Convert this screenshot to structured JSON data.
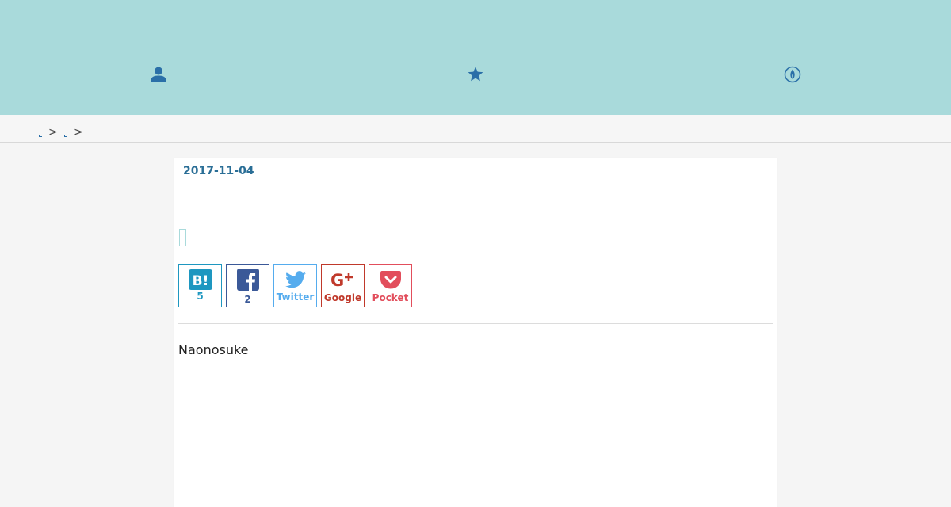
{
  "header": {
    "background": "#a9dadb",
    "icons": [
      "user-icon",
      "star-icon",
      "fire-icon"
    ],
    "icon_color": "#2a6fa8"
  },
  "breadcrumb": {
    "separator": ">"
  },
  "article": {
    "date": "2017-11-04",
    "author": "Naonosuke"
  },
  "share": {
    "hatena": {
      "icon": "hatena-bookmark-icon",
      "count": "5",
      "color": "#1e97c0"
    },
    "facebook": {
      "icon": "facebook-icon",
      "count": "2",
      "color": "#3b5998"
    },
    "twitter": {
      "icon": "twitter-icon",
      "label": "Twitter",
      "color": "#55acee"
    },
    "google": {
      "icon": "google-plus-icon",
      "label": "Google",
      "color": "#c0392b"
    },
    "pocket": {
      "icon": "pocket-icon",
      "label": "Pocket",
      "color": "#e24e5c"
    }
  }
}
